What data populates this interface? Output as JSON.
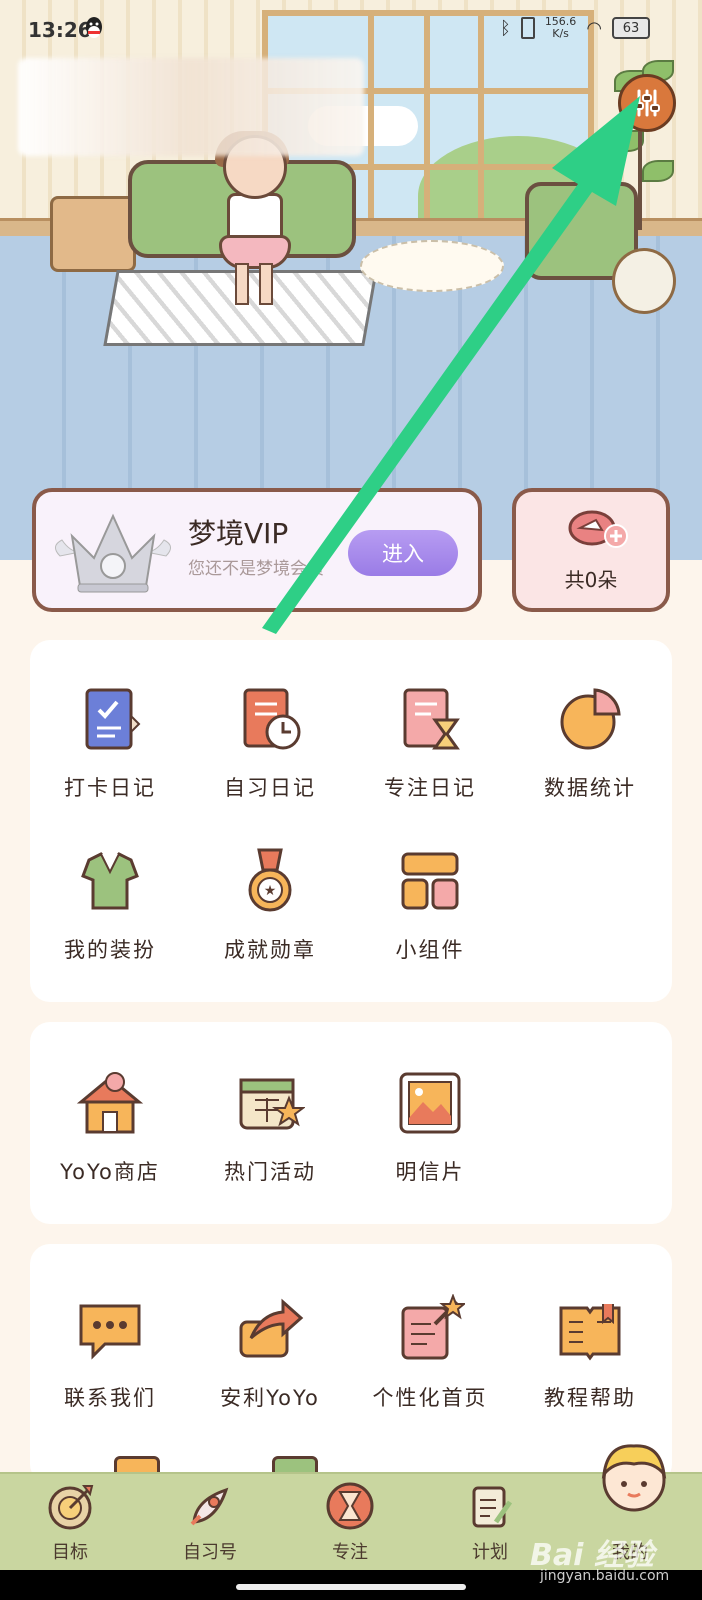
{
  "status_bar": {
    "time": "13:26",
    "net_speed_value": "156.6",
    "net_speed_unit": "K/s",
    "battery": "63"
  },
  "vip": {
    "title": "梦境VIP",
    "subtitle": "您还不是梦境会员",
    "enter_label": "进入"
  },
  "flowers": {
    "count_label": "共0朵"
  },
  "menu_sections": [
    {
      "items": [
        {
          "label": "打卡日记",
          "icon": "checkin-diary-icon"
        },
        {
          "label": "自习日记",
          "icon": "study-diary-icon"
        },
        {
          "label": "专注日记",
          "icon": "focus-diary-icon"
        },
        {
          "label": "数据统计",
          "icon": "statistics-pie-icon"
        },
        {
          "label": "我的装扮",
          "icon": "outfit-icon"
        },
        {
          "label": "成就勋章",
          "icon": "medal-icon"
        },
        {
          "label": "小组件",
          "icon": "widget-icon"
        }
      ]
    },
    {
      "items": [
        {
          "label": "YoYo商店",
          "icon": "shop-icon"
        },
        {
          "label": "热门活动",
          "icon": "event-calendar-icon"
        },
        {
          "label": "明信片",
          "icon": "postcard-icon"
        }
      ]
    },
    {
      "items": [
        {
          "label": "联系我们",
          "icon": "chat-bubble-icon"
        },
        {
          "label": "安利YoYo",
          "icon": "share-icon"
        },
        {
          "label": "个性化首页",
          "icon": "customize-home-icon"
        },
        {
          "label": "教程帮助",
          "icon": "tutorial-book-icon"
        }
      ]
    }
  ],
  "bottom_nav": [
    {
      "label": "目标",
      "icon": "target-icon"
    },
    {
      "label": "自习号",
      "icon": "rocket-icon"
    },
    {
      "label": "专注",
      "icon": "hourglass-icon"
    },
    {
      "label": "计划",
      "icon": "clipboard-icon"
    },
    {
      "label": "我的",
      "icon": "avatar-icon"
    }
  ],
  "watermark": {
    "brand": "Bai 经验",
    "url": "jingyan.baidu.com"
  },
  "colors": {
    "accent": "#9a7ce6",
    "nav_bg": "#c9d6a0",
    "arrow": "#2ecf86",
    "settings": "#d9783c"
  }
}
